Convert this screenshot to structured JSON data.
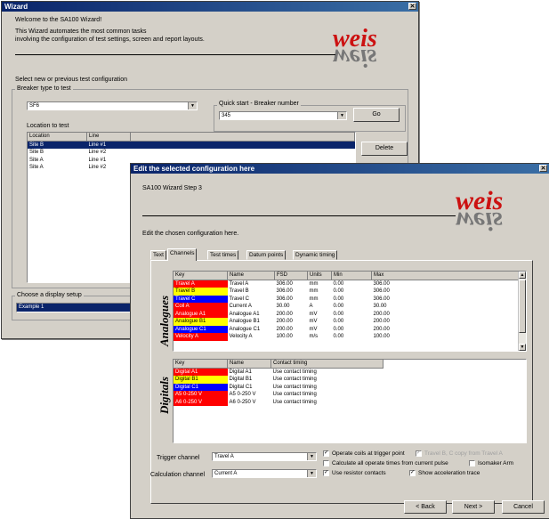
{
  "wizard": {
    "title": "Wizard",
    "welcome_line1": "Welcome to the SA100 Wizard!",
    "welcome_line2": "This Wizard automates the most common tasks",
    "welcome_line3": "involving the configuration of test settings, screen and report layouts.",
    "select_prompt": "Select new or previous test configuration",
    "breaker_type_label": "Breaker type to test",
    "breaker_type_value": "SF6",
    "quick_start_label": "Quick start - Breaker number",
    "quick_start_value": "345",
    "go_label": "Go",
    "location_label": "Location to test",
    "location_columns": [
      "Location",
      "Line"
    ],
    "location_rows": [
      [
        "Site B",
        "Line #1"
      ],
      [
        "Site B",
        "Line #2"
      ],
      [
        "Site A",
        "Line #1"
      ],
      [
        "Site A",
        "Line #2"
      ]
    ],
    "delete_label": "Delete",
    "display_setup_label": "Choose a display setup",
    "display_setup_value": "Example 1"
  },
  "config": {
    "title": "Edit the selected configuration here",
    "step_label": "SA100 Wizard Step 3",
    "edit_prompt": "Edit the chosen configuration here.",
    "tabs": [
      "Text",
      "Channels",
      "Test times",
      "Datum points",
      "Dynamic timing"
    ],
    "active_tab": 1,
    "analogues_label": "Analogues",
    "analogue_columns": [
      "Key",
      "Name",
      "FSD",
      "Units",
      "Min",
      "Max"
    ],
    "analogue_rows": [
      {
        "key": "Travel A",
        "color": "#ff0000",
        "text": "#ffffff",
        "name": "Travel A",
        "fsd": "306.00",
        "units": "mm",
        "min": "0.00",
        "max": "306.00"
      },
      {
        "key": "Travel B",
        "color": "#ffff00",
        "text": "#000000",
        "name": "Travel B",
        "fsd": "306.00",
        "units": "mm",
        "min": "0.00",
        "max": "306.00"
      },
      {
        "key": "Travel C",
        "color": "#0000ff",
        "text": "#ffffff",
        "name": "Travel C",
        "fsd": "306.00",
        "units": "mm",
        "min": "0.00",
        "max": "306.00"
      },
      {
        "key": "Coil A",
        "color": "#ff0000",
        "text": "#ffffff",
        "name": "Current A",
        "fsd": "30.00",
        "units": "A",
        "min": "0.00",
        "max": "30.00"
      },
      {
        "key": "Analogue A1",
        "color": "#ff0000",
        "text": "#ffffff",
        "name": "Analogue A1",
        "fsd": "200.00",
        "units": "mV",
        "min": "0.00",
        "max": "200.00"
      },
      {
        "key": "Analogue B1",
        "color": "#ffff00",
        "text": "#000000",
        "name": "Analogue B1",
        "fsd": "200.00",
        "units": "mV",
        "min": "0.00",
        "max": "200.00"
      },
      {
        "key": "Analogue C1",
        "color": "#0000ff",
        "text": "#ffffff",
        "name": "Analogue C1",
        "fsd": "200.00",
        "units": "mV",
        "min": "0.00",
        "max": "200.00"
      },
      {
        "key": "Velocity A",
        "color": "#ff0000",
        "text": "#ffffff",
        "name": "Velocity A",
        "fsd": "100.00",
        "units": "m/s",
        "min": "0.00",
        "max": "100.00"
      }
    ],
    "digitals_label": "Digitals",
    "digital_columns": [
      "Key",
      "Name",
      "Contact timing"
    ],
    "digital_rows": [
      {
        "key": "Digital A1",
        "color": "#ff0000",
        "text": "#ffffff",
        "name": "Digital A1",
        "timing": "Use contact timing"
      },
      {
        "key": "Digital B1",
        "color": "#ffff00",
        "text": "#000000",
        "name": "Digital B1",
        "timing": "Use contact timing"
      },
      {
        "key": "Digital C1",
        "color": "#0000ff",
        "text": "#ffffff",
        "name": "Digital C1",
        "timing": "Use contact timing"
      },
      {
        "key": "A5 0-250 V",
        "color": "#ff0000",
        "text": "#ffffff",
        "name": "A5 0-250 V",
        "timing": "Use contact timing"
      },
      {
        "key": "A6 0-250 V",
        "color": "#ff0000",
        "text": "#ffffff",
        "name": "A6 0-250 V",
        "timing": "Use contact timing"
      }
    ],
    "trigger_label": "Trigger channel",
    "trigger_value": "Travel A",
    "calc_label": "Calculation channel",
    "calc_value": "Current A",
    "opt_operate_coils": "Operate coils at trigger point",
    "opt_travel_copy": "Travel B, C copy from Travel A",
    "opt_calc_all": "Calculate all operate times from current pulse",
    "opt_isomaker": "Isomaker Arm",
    "opt_resistor": "Use resistor contacts",
    "opt_accel": "Show acceleration trace",
    "back_label": "< Back",
    "next_label": "Next >",
    "cancel_label": "Cancel"
  }
}
